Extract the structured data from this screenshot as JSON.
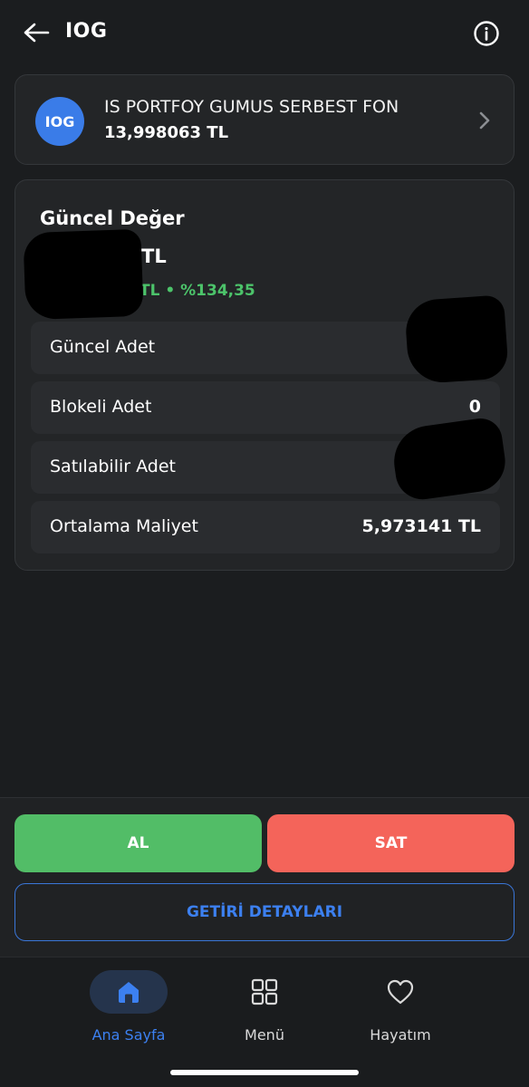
{
  "header": {
    "title": "IOG",
    "back_icon": "arrow-left-icon",
    "info_icon": "info-icon"
  },
  "fund": {
    "logo_text": "IOG",
    "name": "IS PORTFOY GUMUS SERBEST FON",
    "price": "13,998063 TL",
    "chevron_icon": "chevron-right-icon"
  },
  "value": {
    "title": "Güncel Değer",
    "amount_visible": "TL",
    "change_visible": "TL • %134,35",
    "rows": [
      {
        "label": "Güncel Adet",
        "value": ""
      },
      {
        "label": "Blokeli Adet",
        "value": "0"
      },
      {
        "label": "Satılabilir Adet",
        "value": ""
      },
      {
        "label": "Ortalama Maliyet",
        "value": "5,973141 TL"
      }
    ]
  },
  "actions": {
    "buy_label": "AL",
    "sell_label": "SAT",
    "returns_label": "GETİRİ DETAYLARI"
  },
  "tabs": [
    {
      "label": "Ana Sayfa",
      "icon": "home-icon",
      "active": true
    },
    {
      "label": "Menü",
      "icon": "grid-icon",
      "active": false
    },
    {
      "label": "Hayatım",
      "icon": "heart-icon",
      "active": false
    }
  ],
  "colors": {
    "background": "#1b1d1f",
    "card": "#232527",
    "accent_blue": "#3c80f0",
    "buy_green": "#52bd67",
    "sell_red": "#f4645a",
    "positive_text": "#4cc36a"
  }
}
